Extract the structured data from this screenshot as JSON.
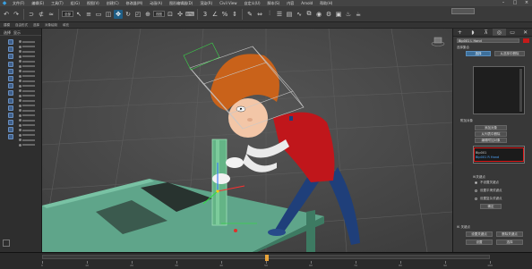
{
  "menubar": {
    "items": [
      "文件(F)",
      "编辑(E)",
      "工具(T)",
      "组(G)",
      "视图(V)",
      "创建(C)",
      "修改器(M)",
      "动画(A)",
      "图形编辑器(D)",
      "渲染(R)",
      "Civil View",
      "自定义(U)",
      "脚本(S)",
      "内容",
      "Arnold",
      "帮助(H)"
    ]
  },
  "toolbar": {
    "filter_value": "全部",
    "view_value": "视图"
  },
  "toolbar2": {
    "items": [
      "建模",
      "自由形式",
      "选择",
      "对象绘制",
      "填充"
    ]
  },
  "scene_explorer": {
    "tabs": [
      "选择",
      "显示"
    ]
  },
  "viewport": {
    "label": "[+] [正交] [用户定义] [默认明暗处理]"
  },
  "command_panel": {
    "object_name": "Bip001 L Hand",
    "section_selection": "选择集合",
    "btn_select": "选择",
    "btn_deselect": "从选择中删除",
    "section_attachments": "附加对象",
    "btn_add": "添加对象",
    "btn_remove": "从列表中删除",
    "btn_edit": "编辑附加对象",
    "sel_row_1": "Bip001",
    "sel_row_2": "Bip001 R Hand",
    "label_ik": "IK关键点",
    "label_opt_1": "不设置关键点",
    "label_opt_2": "设置平滑关键点",
    "label_opt_3": "设置复杂关键点",
    "btn_ok": "确定",
    "section_misc": "IK 关键点",
    "btn_a": "设置关键点",
    "btn_b": "删除关键点",
    "btn_c": "设置",
    "btn_d": "选择"
  },
  "timeline": {
    "current_frame": 50,
    "frame_max": 100,
    "ticks": [
      0,
      10,
      20,
      30,
      40,
      50,
      60,
      70,
      80,
      90,
      100
    ]
  },
  "colors": {
    "accent": "#1f5e86",
    "highlight_red": "#e01b1b",
    "object_red": "#c51a1a",
    "table_green": "#5fa58a",
    "shirt_red": "#c0161b",
    "pants_blue": "#1f3f7a",
    "hair_orange": "#c9621a"
  }
}
